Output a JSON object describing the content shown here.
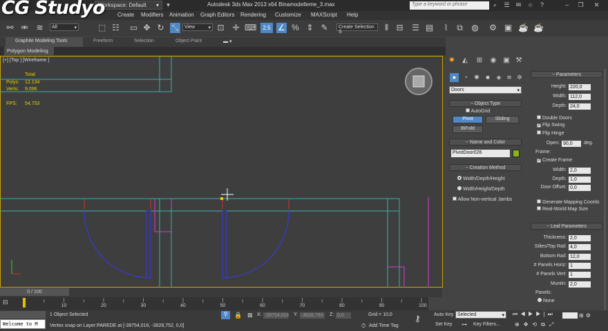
{
  "app": {
    "title": "Autodesk 3ds Max  2013 x64    Binamodelleme_3.max",
    "workspace": "Workspace: Default",
    "search_placeholder": "Type a keyword or phrase",
    "watermark": "CG Studyo"
  },
  "menus": [
    "Create",
    "Modifiers",
    "Animation",
    "Graph Editors",
    "Rendering",
    "Customize",
    "MAXScript",
    "Help"
  ],
  "toolbar": {
    "filter": "All",
    "coord_system": "View",
    "selection_set": "Create Selection S",
    "snap_label": "2.5"
  },
  "ribbon": {
    "tabs": [
      "Graphite Modeling Tools",
      "Freeform",
      "Selection",
      "Object Paint"
    ],
    "panel": "Polygon Modeling"
  },
  "viewport": {
    "label": "[+] [Top ] [Wireframe ]",
    "stats": {
      "total_label": "Total",
      "polys_label": "Polys:",
      "polys": "12.134",
      "verts_label": "Verts:",
      "verts": "9.096",
      "fps_label": "FPS:",
      "fps": "54,753"
    }
  },
  "command_panel": {
    "category": "Doors",
    "object_type": {
      "title": "Object Type",
      "autogrid": "AutoGrid",
      "buttons": [
        "Pivot",
        "Sliding",
        "BiFold"
      ]
    },
    "name_color": {
      "title": "Name and Color",
      "name": "PivotDoor026",
      "color": "#8ab41a"
    },
    "creation_method": {
      "title": "Creation Method",
      "options": [
        "Width/Depth/Height",
        "Width/Height/Depth"
      ],
      "allow": "Allow Non-vertical Jambs"
    }
  },
  "parameters": {
    "title": "Parameters",
    "height_label": "Height:",
    "height": "220,0",
    "width_label": "Width:",
    "width": "112,0",
    "depth_label": "Depth:",
    "depth": "24,0",
    "double_doors": "Double Doors",
    "flip_swing": "Flip Swing",
    "flip_hinge": "Flip Hinge",
    "open_label": "Open:",
    "open": "90,0",
    "open_unit": "deg.",
    "frame_label": "Frame:",
    "create_frame": "Create Frame",
    "fwidth_label": "Width:",
    "fwidth": "2,0",
    "fdepth_label": "Depth:",
    "fdepth": "1,0",
    "door_offset_label": "Door Offset:",
    "door_offset": "0,0",
    "gen_mapping": "Generate Mapping Coords",
    "real_world": "Real-World Map Size"
  },
  "leaf": {
    "title": "Leaf Parameters",
    "thickness_label": "Thickness:",
    "thickness": "2,0",
    "stiles_label": "Stiles/Top Rail:",
    "stiles": "4,0",
    "bottom_label": "Bottom Rail:",
    "bottom": "12,0",
    "horiz_label": "# Panels Horiz:",
    "horiz": "1",
    "vert_label": "# Panels Vert:",
    "vert": "1",
    "muntin_label": "Muntin:",
    "muntin": "2,0",
    "panels_label": "Panels:",
    "none": "None"
  },
  "timeline": {
    "slider": "0 / 100",
    "ticks": [
      "10",
      "20",
      "30",
      "40",
      "50",
      "60",
      "70",
      "80",
      "90",
      "100"
    ]
  },
  "status": {
    "welcome": "Welcome to M",
    "selected": "1 Object Selected",
    "prompt": "Vertex snap on Layer:PAREDE at [-39754,016, -3628,752, 0,0]",
    "x_label": "X:",
    "x": "-39754,016",
    "y_label": "Y:",
    "y": "-3628,753",
    "z_label": "Z:",
    "z": "0,0",
    "grid": "Grid = 10,0",
    "add_time_tag": "Add Time Tag",
    "auto_key": "Auto Key",
    "set_key": "Set Key",
    "key_mode": "Selected",
    "key_filters": "Key Filters..."
  }
}
